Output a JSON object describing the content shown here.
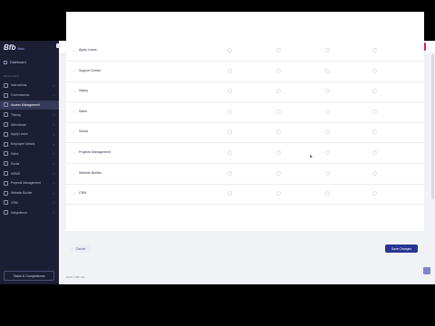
{
  "app": {
    "logo_main": "Bfb",
    "logo_sub": "ftab"
  },
  "sidebar": {
    "dashboard_label": "Dashboard",
    "section_label": "RESUMEN",
    "items": [
      {
        "label": "Instructions"
      },
      {
        "label": "Commissions"
      },
      {
        "label": "Access Management"
      },
      {
        "label": "Ticking"
      },
      {
        "label": "Attendance"
      },
      {
        "label": "Apply Leave"
      },
      {
        "label": "Employee Details"
      },
      {
        "label": "Sales"
      },
      {
        "label": "Social"
      },
      {
        "label": "HRMS"
      },
      {
        "label": "Projects Management"
      },
      {
        "label": "Website Builder"
      },
      {
        "label": "CRM"
      },
      {
        "label": "Integrations"
      }
    ],
    "support_label": "Tasks & Comparisons"
  },
  "permissions": {
    "rows": [
      {
        "label": "Apply Leave"
      },
      {
        "label": "Support Center"
      },
      {
        "label": "Salary"
      },
      {
        "label": "Sales"
      },
      {
        "label": "Social"
      },
      {
        "label": "Projects Management"
      },
      {
        "label": "Website Builder"
      },
      {
        "label": "CRM"
      }
    ]
  },
  "actions": {
    "cancel_label": "Cancel",
    "save_label": "Save Changes"
  },
  "footer": {
    "text": "2025 © Bfb ftab"
  },
  "colors": {
    "sidebar_bg": "#1c1f33",
    "primary": "#283593",
    "accent": "#e11584"
  }
}
